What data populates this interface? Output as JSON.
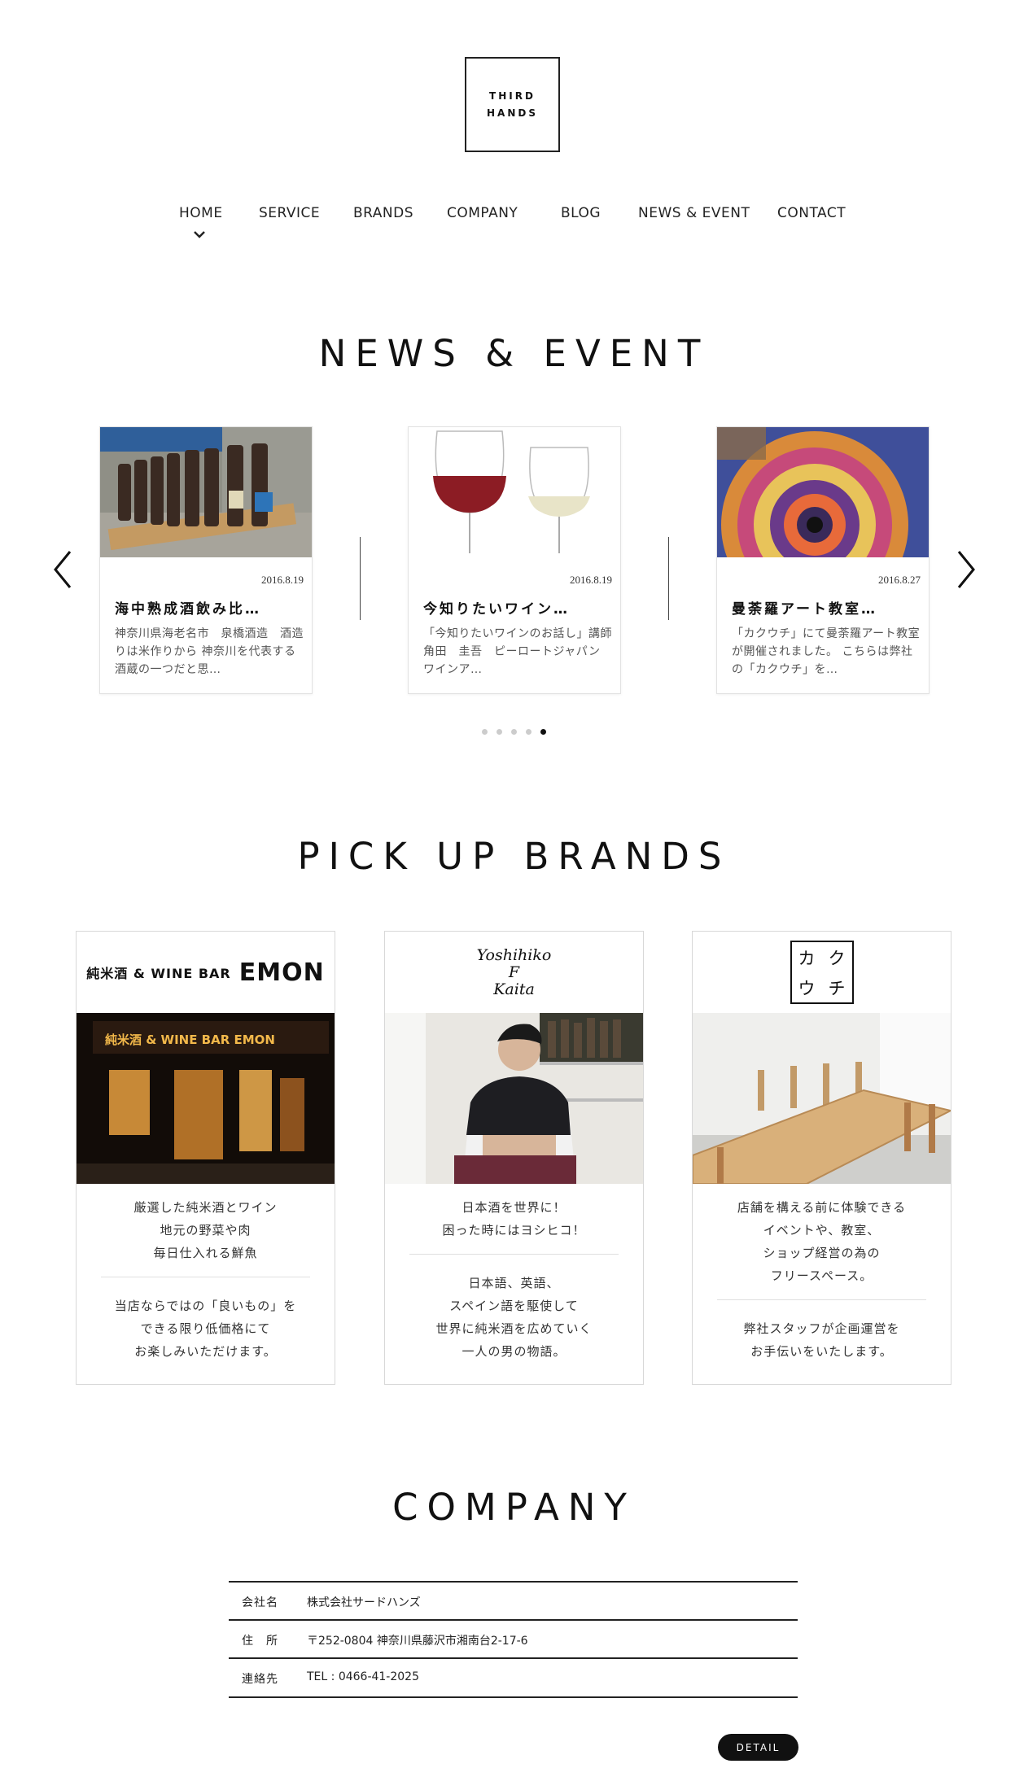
{
  "header": {
    "logo_line1": "THIRD",
    "logo_line2": "HANDS",
    "nav": [
      {
        "label": "HOME",
        "active": true
      },
      {
        "label": "SERVICE"
      },
      {
        "label": "BRANDS"
      },
      {
        "label": "COMPANY"
      },
      {
        "label": "BLOG"
      },
      {
        "label": "NEWS & EVENT"
      },
      {
        "label": "CONTACT"
      }
    ]
  },
  "news": {
    "title": "NEWS  &  EVENT",
    "cards": [
      {
        "date": "2016.8.19",
        "title": "海中熟成酒飲み比…",
        "body": "神奈川県海老名市　泉橋酒造　酒造りは米作りから 神奈川を代表する酒蔵の一つだと思…"
      },
      {
        "date": "2016.8.19",
        "title": "今知りたいワイン…",
        "body": "「今知りたいワインのお話し」講師　角田　圭吾　ピーロートジャパン　ワインア…"
      },
      {
        "date": "2016.8.27",
        "title": "曼荼羅アート教室…",
        "body": "「カクウチ」にて曼荼羅アート教室が開催されました。 こちらは弊社の「カクウチ」を…"
      }
    ],
    "dots_count": 5,
    "active_dot": 5
  },
  "brands": {
    "title": "PICK  UP  BRANDS",
    "cards": [
      {
        "logo_small": "純米酒 & WINE BAR",
        "logo_big": "EMON",
        "sign_text": "純米酒 & WINE BAR EMON",
        "text1": [
          "厳選した純米酒とワイン",
          "地元の野菜や肉",
          "毎日仕入れる鮮魚"
        ],
        "text2": [
          "当店ならではの「良いもの」を",
          "できる限り低価格にて",
          "お楽しみいただけます。"
        ]
      },
      {
        "logo_lines": [
          "Yoshihiko",
          "F",
          "Kaita"
        ],
        "text1": [
          "日本酒を世界に！",
          "困った時にはヨシヒコ！"
        ],
        "text2": [
          "日本語、英語、",
          "スペイン語を駆使して",
          "世界に純米酒を広めていく",
          "一人の男の物語。"
        ]
      },
      {
        "logo_chars": [
          "カ",
          "ク",
          "ウ",
          "チ"
        ],
        "text1": [
          "店舗を構える前に体験できる",
          "イベントや、教室、",
          "ショップ経営の為の",
          "フリースペース。"
        ],
        "text2": [
          "弊社スタッフが企画運営を",
          "お手伝いをいたします。"
        ]
      }
    ]
  },
  "company": {
    "title": "COMPANY",
    "rows": [
      {
        "key": "会社名",
        "value": "株式会社サードハンズ"
      },
      {
        "key": "住　所",
        "value": "〒252-0804 神奈川県藤沢市湘南台2-17-6"
      },
      {
        "key": "連絡先",
        "value": "TEL : 0466-41-2025"
      }
    ],
    "detail_label": "DETAIL"
  },
  "icons": {
    "prev": "chevron-left-icon",
    "next": "chevron-right-icon",
    "nav_indicator": "chevron-down-icon"
  }
}
